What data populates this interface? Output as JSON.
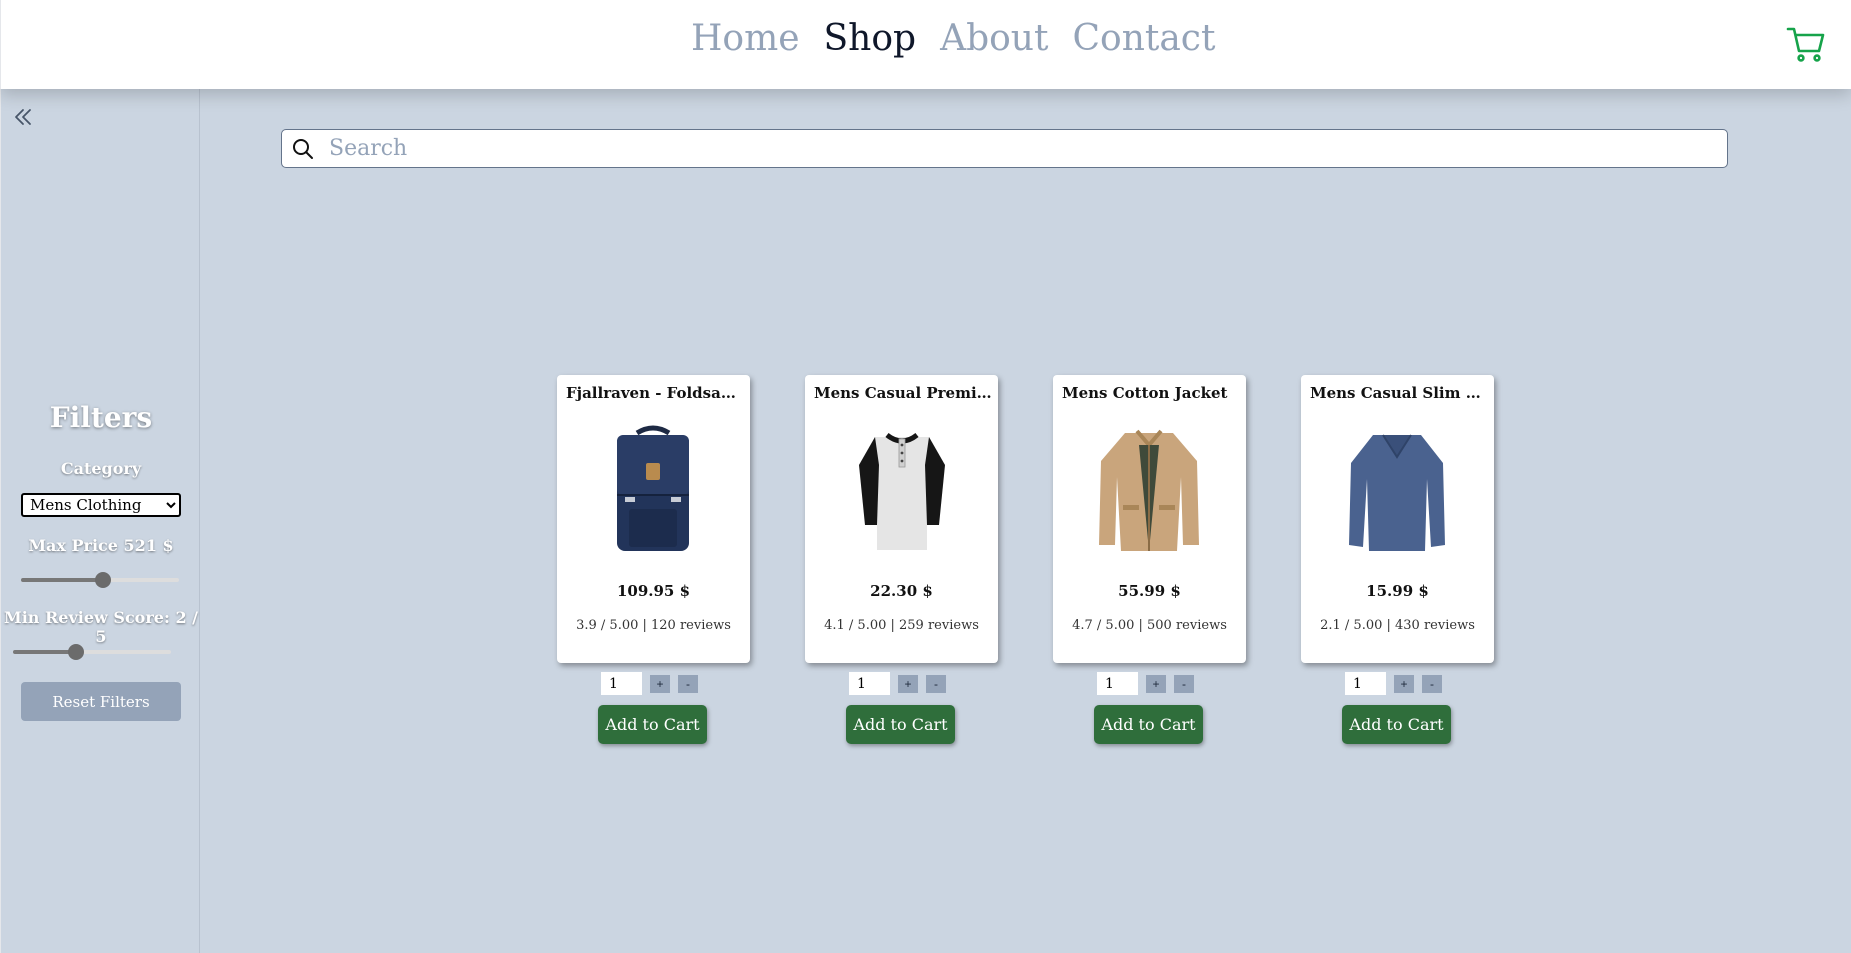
{
  "nav": {
    "items": [
      {
        "label": "Home",
        "active": false
      },
      {
        "label": "Shop",
        "active": true
      },
      {
        "label": "About",
        "active": false
      },
      {
        "label": "Contact",
        "active": false
      }
    ]
  },
  "cart": {
    "icon": "cart-icon",
    "color": "#16a34a"
  },
  "sidebar": {
    "collapse_icon": "double-chevron-left-icon",
    "title": "Filters",
    "category_label": "Category",
    "category_value": "Mens Clothing",
    "max_price_label": "Max Price 521 $",
    "max_price_fraction": 0.52,
    "min_review_label": "Min Review Score: 2 / 5",
    "min_review_fraction": 0.4,
    "reset_label": "Reset Filters"
  },
  "search": {
    "placeholder": "Search"
  },
  "products": [
    {
      "title": "Fjallraven - Foldsack ...",
      "price": "109.95 $",
      "review": "3.9 / 5.00 | 120 reviews",
      "qty": "1",
      "plus": "+",
      "minus": "-",
      "add_label": "Add to Cart",
      "image": "backpack"
    },
    {
      "title": "Mens Casual Premiu...",
      "price": "22.30 $",
      "review": "4.1 / 5.00 | 259 reviews",
      "qty": "1",
      "plus": "+",
      "minus": "-",
      "add_label": "Add to Cart",
      "image": "henley-shirt"
    },
    {
      "title": "Mens Cotton Jacket",
      "price": "55.99 $",
      "review": "4.7 / 5.00 | 500 reviews",
      "qty": "1",
      "plus": "+",
      "minus": "-",
      "add_label": "Add to Cart",
      "image": "cotton-jacket"
    },
    {
      "title": "Mens Casual Slim Fit",
      "price": "15.99 $",
      "review": "2.1 / 5.00 | 430 reviews",
      "qty": "1",
      "plus": "+",
      "minus": "-",
      "add_label": "Add to Cart",
      "image": "slim-fit-shirt"
    }
  ]
}
